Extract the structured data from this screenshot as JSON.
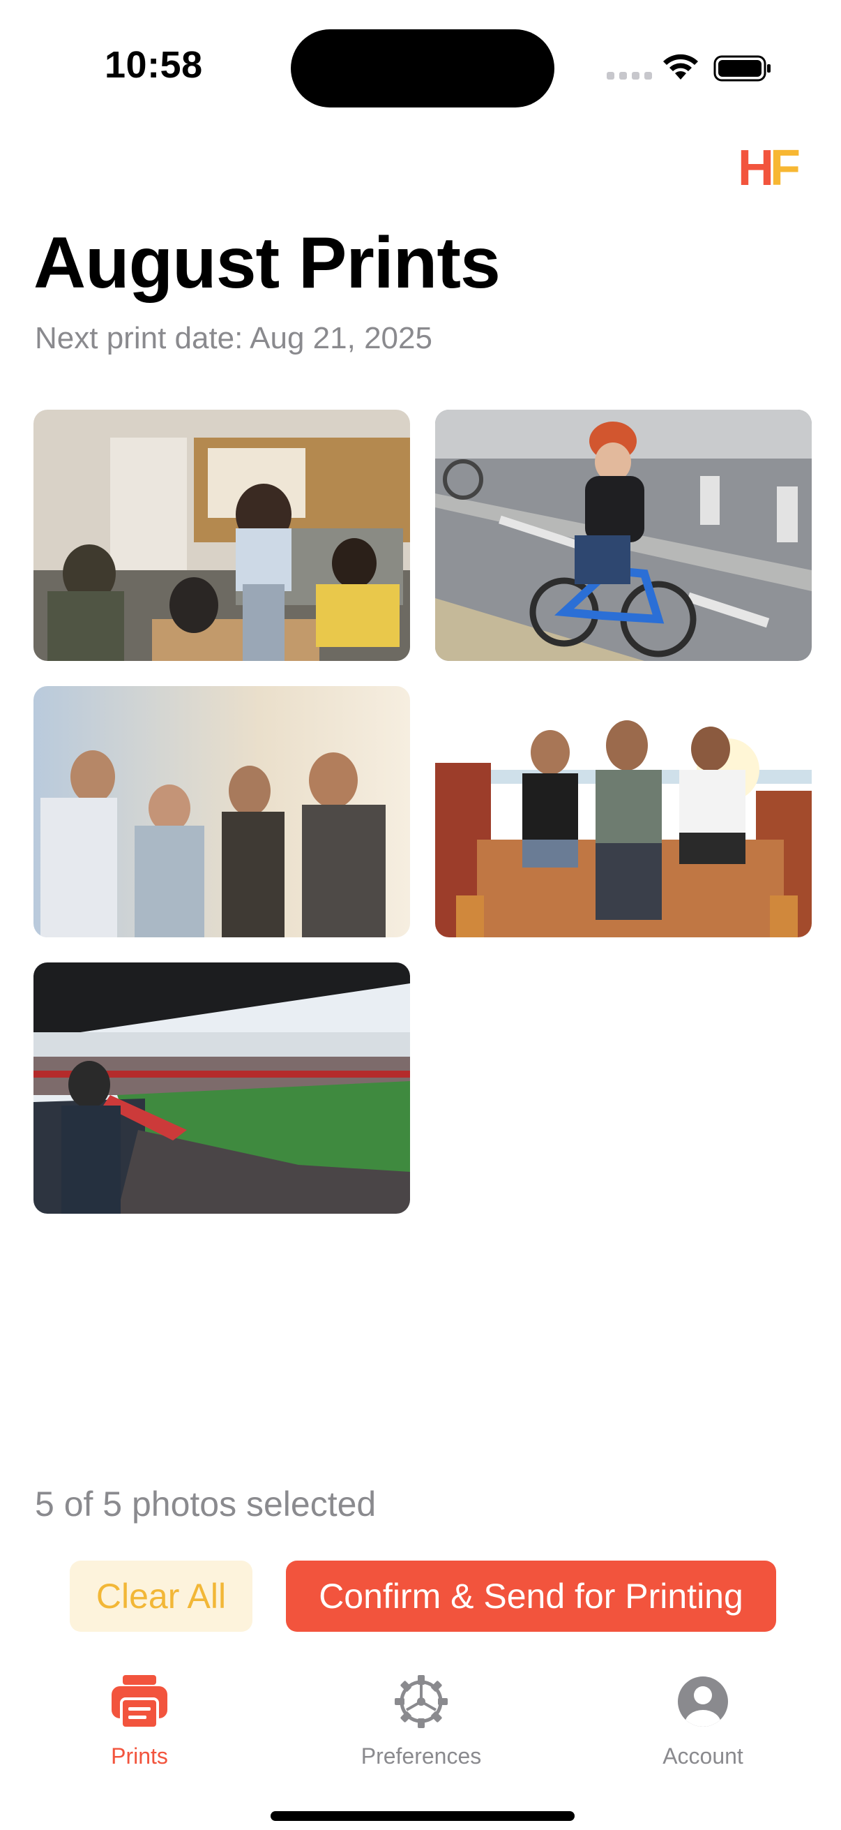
{
  "status_bar": {
    "time": "10:58"
  },
  "brand": {
    "logo_h": "H",
    "logo_f": "F",
    "accent": "#f2543d",
    "secondary": "#f7b733"
  },
  "header": {
    "title": "August Prints",
    "subtitle": "Next print date: Aug 21, 2025"
  },
  "photos": [
    {
      "icon": "photo-friends-board-game"
    },
    {
      "icon": "photo-boy-on-bicycle"
    },
    {
      "icon": "photo-friends-sunset"
    },
    {
      "icon": "photo-friends-on-wall"
    },
    {
      "icon": "photo-football-stadium"
    }
  ],
  "selection": {
    "text": "5 of 5 photos selected",
    "selected": 5,
    "total": 5
  },
  "actions": {
    "clear_label": "Clear All",
    "confirm_label": "Confirm & Send for Printing"
  },
  "tab_bar": {
    "items": [
      {
        "label": "Prints",
        "icon": "printer-icon",
        "active": true
      },
      {
        "label": "Preferences",
        "icon": "gear-icon",
        "active": false
      },
      {
        "label": "Account",
        "icon": "person-icon",
        "active": false
      }
    ]
  }
}
